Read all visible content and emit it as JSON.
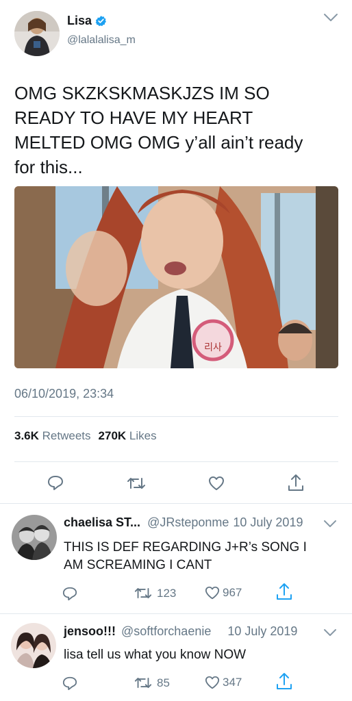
{
  "main_tweet": {
    "author": {
      "name": "Lisa",
      "handle": "@lalalalisa_m",
      "verified": true
    },
    "text_lines": [
      "OMG SKZKSKMASKJZS IM SO",
      "READY TO HAVE MY HEART",
      "MELTED OMG OMG y’all ain’t ready",
      "for this..."
    ],
    "timestamp": "06/10/2019, 23:34",
    "stats": {
      "retweets_count": "3.6K",
      "retweets_label": "Retweets",
      "likes_count": "270K",
      "likes_label": "Likes"
    },
    "image_sign_text": "리사"
  },
  "replies": [
    {
      "name": "chaelisa ST...",
      "handle": "@JRsteponme",
      "date": "10 July 2019",
      "text_lines": [
        "THIS IS DEF REGARDING J+R’s SONG I",
        "AM SCREAMING I CANT"
      ],
      "retweets": "123",
      "likes": "967"
    },
    {
      "name": "jensoo!!!",
      "handle": "@softforchaenie",
      "date": "10 July 2019",
      "text_lines": [
        "lisa tell us what you know NOW"
      ],
      "retweets": "85",
      "likes": "347"
    }
  ],
  "colors": {
    "brand_blue": "#1da1f2",
    "muted": "#657786",
    "text": "#14171a",
    "divider": "#e1e8ed"
  },
  "icons": [
    "chevron-down-icon",
    "verified-badge-icon",
    "reply-icon",
    "retweet-icon",
    "like-icon",
    "share-icon"
  ]
}
